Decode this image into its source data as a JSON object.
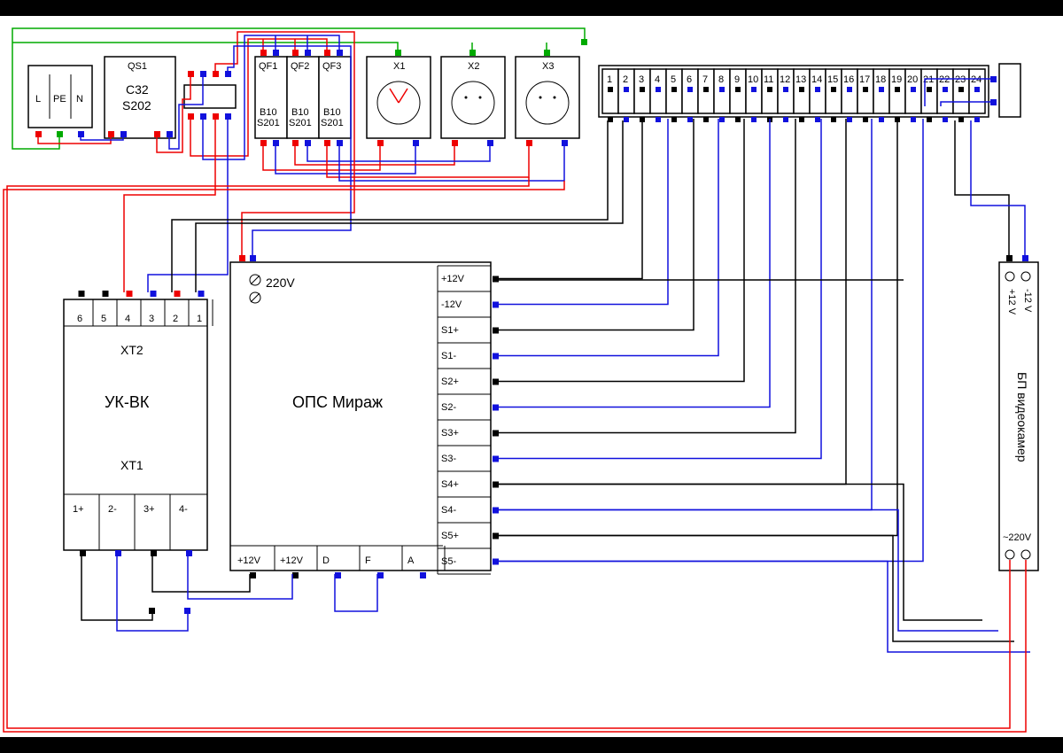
{
  "input": {
    "L": "L",
    "PE": "PE",
    "N": "N"
  },
  "breaker_main": {
    "id": "QS1",
    "model_line1": "C32",
    "model_line2": "S202"
  },
  "breakers": [
    {
      "id": "QF1",
      "l1": "B10",
      "l2": "S201"
    },
    {
      "id": "QF2",
      "l1": "B10",
      "l2": "S201"
    },
    {
      "id": "QF3",
      "l1": "B10",
      "l2": "S201"
    }
  ],
  "sockets": [
    {
      "id": "X1"
    },
    {
      "id": "X2"
    },
    {
      "id": "X3"
    }
  ],
  "terminal_strip": {
    "count": 24
  },
  "ukvk": {
    "name": "УК-ВК",
    "top_header": "XT2",
    "bottom_header": "XT1",
    "top_pins": [
      "6",
      "5",
      "4",
      "3",
      "2",
      "1"
    ],
    "bottom_pins": [
      "1+",
      "2-",
      "3+",
      "4-"
    ]
  },
  "ops": {
    "name": "ОПС Мираж",
    "power_label": "220V",
    "right_pins": [
      "+12V",
      "-12V",
      "S1+",
      "S1-",
      "S2+",
      "S2-",
      "S3+",
      "S3-",
      "S4+",
      "S4-",
      "S5+",
      "S5-"
    ],
    "bottom_pins": [
      "+12V",
      "+12V",
      "D",
      "F",
      "A"
    ]
  },
  "psu": {
    "name": "БП видеокамер",
    "out_plus": "+12 V",
    "out_minus": "-12 V",
    "in": "~220V"
  }
}
